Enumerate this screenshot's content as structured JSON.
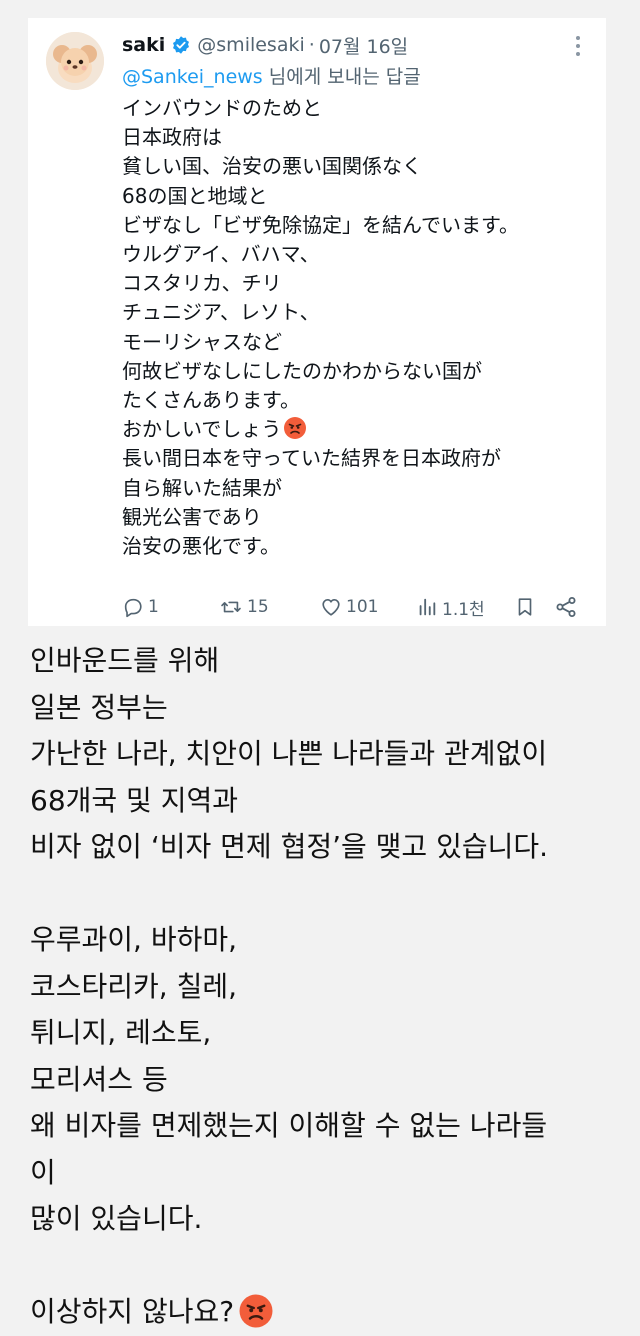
{
  "tweet": {
    "display_name": "saki",
    "handle": "@smilesaki",
    "separator": "·",
    "date": "07월 16일",
    "reply_to": "@Sankei_news",
    "reply_suffix": " 님에게 보내는 답글",
    "lines": [
      "インバウンドのためと",
      "日本政府は",
      "貧しい国、治安の悪い国関係なく",
      "68の国と地域と",
      "ビザなし「ビザ免除協定」を結んでいます。",
      "ウルグアイ、バハマ、",
      "コスタリカ、チリ",
      "チュニジア、レソト、",
      "モーリシャスなど",
      "何故ビザなしにしたのかわからない国が",
      "たくさんあります。",
      "おかしいでしょう",
      "長い間日本を守っていた結界を日本政府が",
      "自ら解いた結果が",
      "観光公害であり",
      "治安の悪化です。"
    ],
    "actions": {
      "replies": "1",
      "retweets": "15",
      "likes": "101",
      "views": "1.1천"
    },
    "icons": {
      "verified": "verified-badge-icon",
      "more": "more-options-icon",
      "reply": "reply-icon",
      "retweet": "retweet-icon",
      "like": "heart-icon",
      "views": "views-chart-icon",
      "bookmark": "bookmark-icon",
      "share": "share-icon",
      "angry": "angry-face-emoji"
    }
  },
  "translation": {
    "lines": [
      "인바운드를 위해",
      "일본 정부는",
      "가난한 나라, 치안이 나쁜 나라들과 관계없이",
      "68개국 및 지역과",
      "비자 없이 ‘비자 면제 협정’을 맺고 있습니다.",
      "",
      "우루과이, 바하마,",
      "코스타리카, 칠레,",
      "튀니지, 레소토,",
      "모리셔스 등",
      "왜 비자를 면제했는지 이해할 수 없는 나라들",
      "이",
      "많이 있습니다.",
      "",
      "이상하지 않나요?"
    ]
  },
  "colors": {
    "link_blue": "#1d9bf0",
    "muted_gray": "#536471",
    "page_background": "#f2f2f2",
    "card_background": "#ffffff"
  }
}
